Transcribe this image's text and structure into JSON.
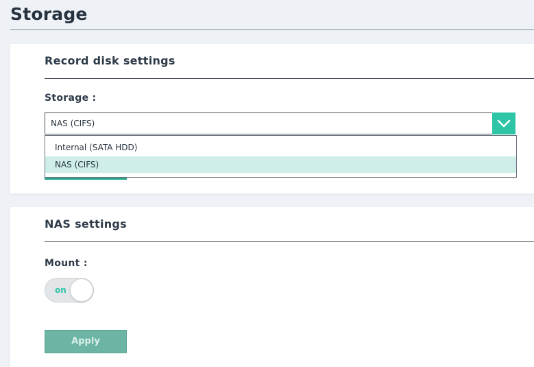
{
  "page": {
    "title": "Storage"
  },
  "record_disk": {
    "heading": "Record disk settings",
    "storage_label": "Storage :",
    "storage_selected": "NAS (CIFS)",
    "storage_options": [
      "Internal (SATA HDD)",
      "NAS (CIFS)"
    ],
    "dropdown_open": true,
    "highlighted_option": "NAS (CIFS)"
  },
  "nas": {
    "heading": "NAS settings",
    "mount_label": "Mount :",
    "mount_state": "on",
    "apply_label": "Apply"
  },
  "colors": {
    "accent": "#2ec4a6",
    "highlight": "#cfeee9",
    "apply_bg": "#6cb5a4"
  },
  "icons": {
    "select_arrow": "chevron-down-icon"
  }
}
